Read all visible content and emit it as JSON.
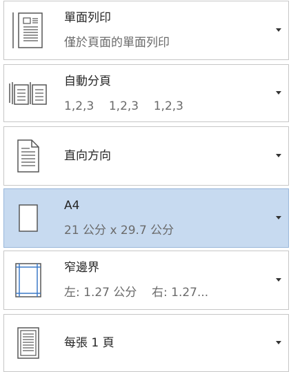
{
  "print_settings": {
    "items": [
      {
        "title": "單面列印",
        "subtitle": "僅於頁面的單面列印",
        "icon": "single-sided-print-icon"
      },
      {
        "title": "自動分頁",
        "subtitle": "1,2,3    1,2,3    1,2,3",
        "icon": "collated-pages-icon"
      },
      {
        "title": "直向方向",
        "subtitle": "",
        "icon": "portrait-orientation-icon"
      },
      {
        "title": "A4",
        "subtitle": "21 公分 x 29.7 公分",
        "icon": "paper-size-icon",
        "selected": true
      },
      {
        "title": "窄邊界",
        "subtitle": "左: 1.27 公分    右: 1.27...",
        "icon": "margins-icon"
      },
      {
        "title": "每張 1 頁",
        "subtitle": "",
        "icon": "pages-per-sheet-icon"
      }
    ]
  },
  "colors": {
    "selected_background": "#c7daf0",
    "border": "#c6c6c6",
    "margin_guide": "#3a78c7"
  }
}
